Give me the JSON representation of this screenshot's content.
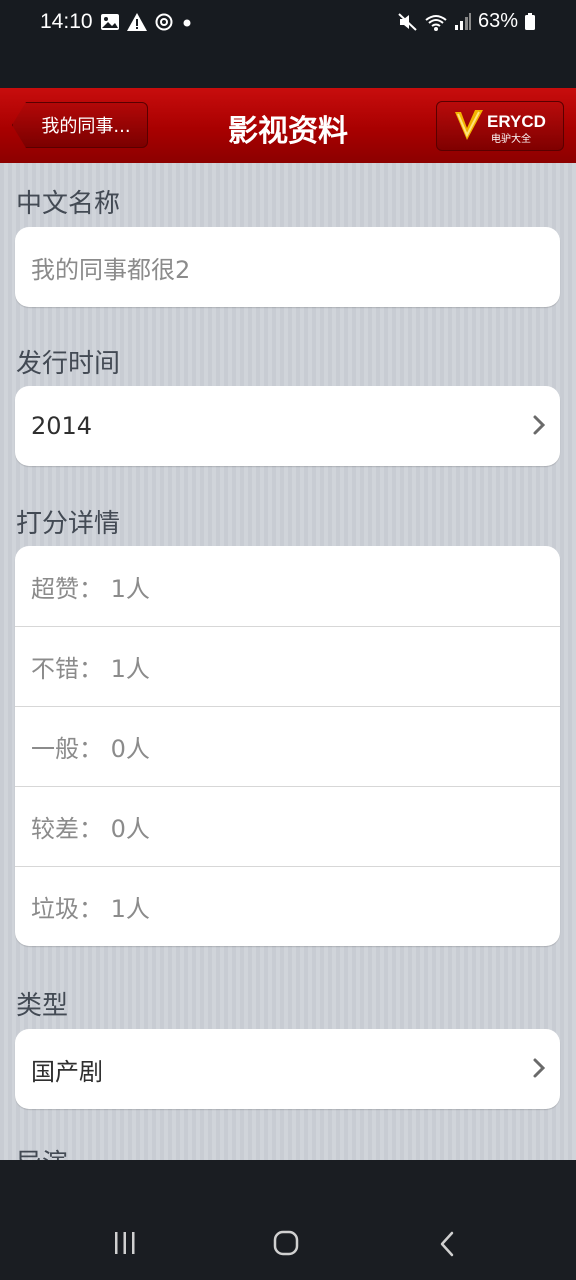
{
  "status_bar": {
    "time": "14:10",
    "battery": "63%"
  },
  "nav_bar": {
    "back_label": "我的同事...",
    "title": "影视资料",
    "logo_main": "ERYCD",
    "logo_sub": "电驴大全"
  },
  "sections": {
    "chinese_name": {
      "header": "中文名称",
      "value": "我的同事都很2"
    },
    "release_time": {
      "header": "发行时间",
      "value": "2014"
    },
    "rating_details": {
      "header": "打分详情",
      "rows": [
        "超赞： 1人",
        "不错： 1人",
        "一般： 0人",
        "较差： 0人",
        "垃圾： 1人"
      ]
    },
    "type": {
      "header": "类型",
      "value": "国产剧"
    },
    "cast": {
      "header": "导演"
    }
  },
  "colors": {
    "nav_red": "#b00000",
    "page_bg": "#c8ccd3"
  },
  "icons": [
    "image-icon",
    "warning-icon",
    "sync-icon",
    "mute-icon",
    "wifi-icon",
    "signal-icon",
    "battery-icon",
    "chevron-right-icon",
    "recent-apps-icon",
    "home-icon",
    "back-icon"
  ]
}
